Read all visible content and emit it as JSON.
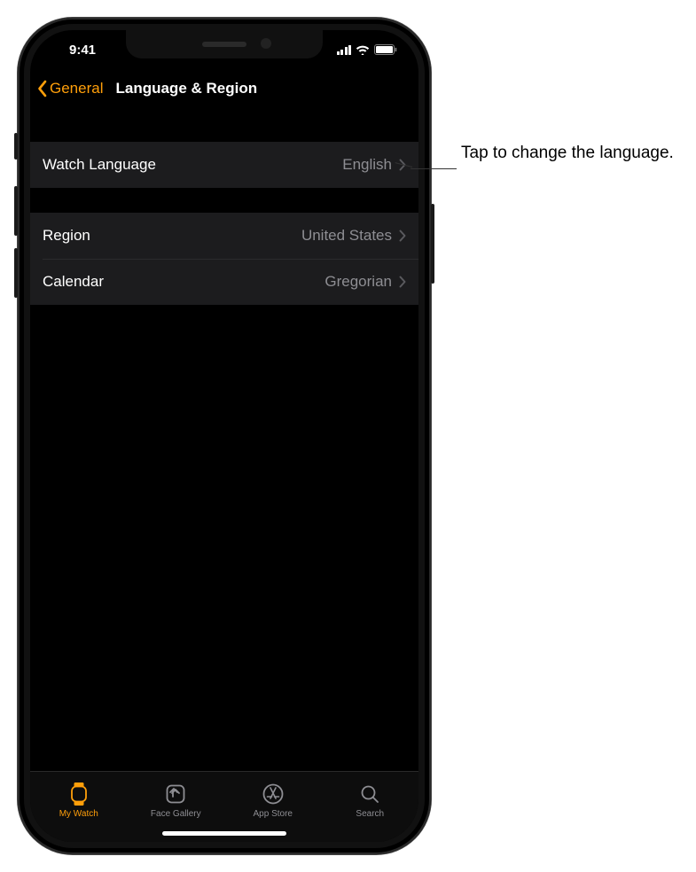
{
  "status": {
    "time": "9:41"
  },
  "nav": {
    "back_label": "General",
    "title": "Language & Region"
  },
  "rows": {
    "watch_language": {
      "label": "Watch Language",
      "value": "English"
    },
    "region": {
      "label": "Region",
      "value": "United States"
    },
    "calendar": {
      "label": "Calendar",
      "value": "Gregorian"
    }
  },
  "tabs": {
    "my_watch": "My Watch",
    "face_gallery": "Face Gallery",
    "app_store": "App Store",
    "search": "Search"
  },
  "callout": {
    "text": "Tap to change the language."
  },
  "colors": {
    "accent": "#ff9f0a"
  }
}
